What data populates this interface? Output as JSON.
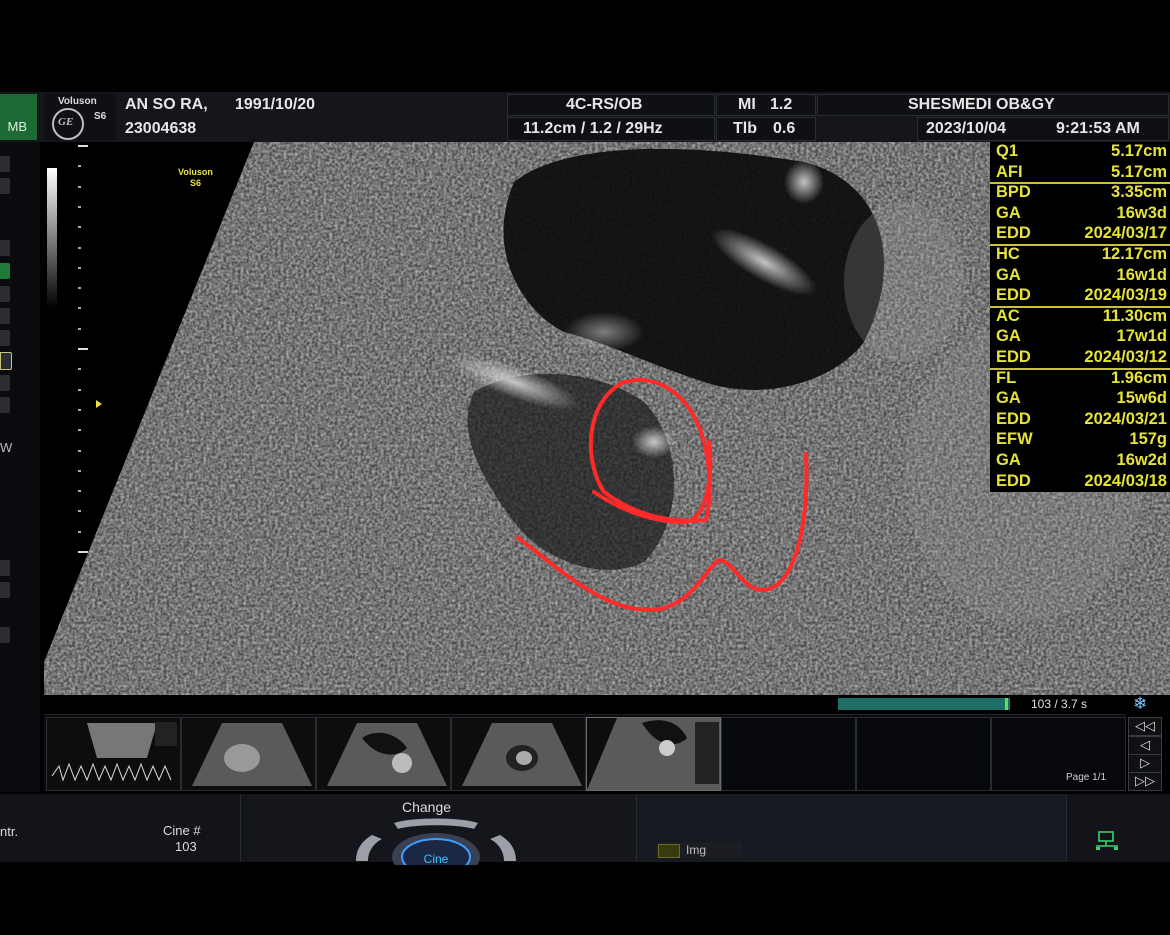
{
  "header": {
    "mode_label": "MB",
    "brand": "Voluson",
    "model": "S6",
    "logo_text": "GE",
    "patient_name": "AN SO RA,",
    "patient_dob": "1991/10/20",
    "patient_id": "23004638",
    "probe": "4C-RS/OB",
    "depth_info": "11.2cm / 1.2 / 29Hz",
    "mi_label": "MI",
    "mi_value": "1.2",
    "tib_label": "Tlb",
    "tib_value": "0.6",
    "institution": "SHESMEDI OB&GY",
    "date": "2023/10/04",
    "time": "9:21:53 AM"
  },
  "scan": {
    "label_brand": "Voluson",
    "label_model": "S6"
  },
  "measurements": [
    {
      "k": "Q1",
      "v": "5.17cm"
    },
    {
      "k": "AFI",
      "v": "5.17cm"
    },
    {
      "k": "BPD",
      "v": "3.35cm"
    },
    {
      "k": "GA",
      "v": "16w3d"
    },
    {
      "k": "EDD",
      "v": "2024/03/17"
    },
    {
      "k": "HC",
      "v": "12.17cm"
    },
    {
      "k": "GA",
      "v": "16w1d"
    },
    {
      "k": "EDD",
      "v": "2024/03/19"
    },
    {
      "k": "AC",
      "v": "11.30cm"
    },
    {
      "k": "GA",
      "v": "17w1d"
    },
    {
      "k": "EDD",
      "v": "2024/03/12"
    },
    {
      "k": "FL",
      "v": "1.96cm"
    },
    {
      "k": "GA",
      "v": "15w6d"
    },
    {
      "k": "EDD",
      "v": "2024/03/21"
    },
    {
      "k": "EFW",
      "v": "157g"
    },
    {
      "k": "GA",
      "v": "16w2d"
    },
    {
      "k": "EDD",
      "v": "2024/03/18"
    }
  ],
  "cine": {
    "progress_fraction": 1.0,
    "frame_info": "103 / 3.7 s",
    "page_label": "Page 1/1"
  },
  "nav_buttons": [
    "◁◁",
    "◁",
    "▷",
    "▷▷"
  ],
  "bottom": {
    "left_label": "ntr.",
    "cine_num_label": "Cine #",
    "cine_num_value": "103",
    "change_label": "Change",
    "knob_label": "Cine",
    "img_label": "Img"
  },
  "colors": {
    "measure_text": "#e6e23a",
    "annotation": "#ff2a2a",
    "mode_green": "#1d6a35"
  }
}
